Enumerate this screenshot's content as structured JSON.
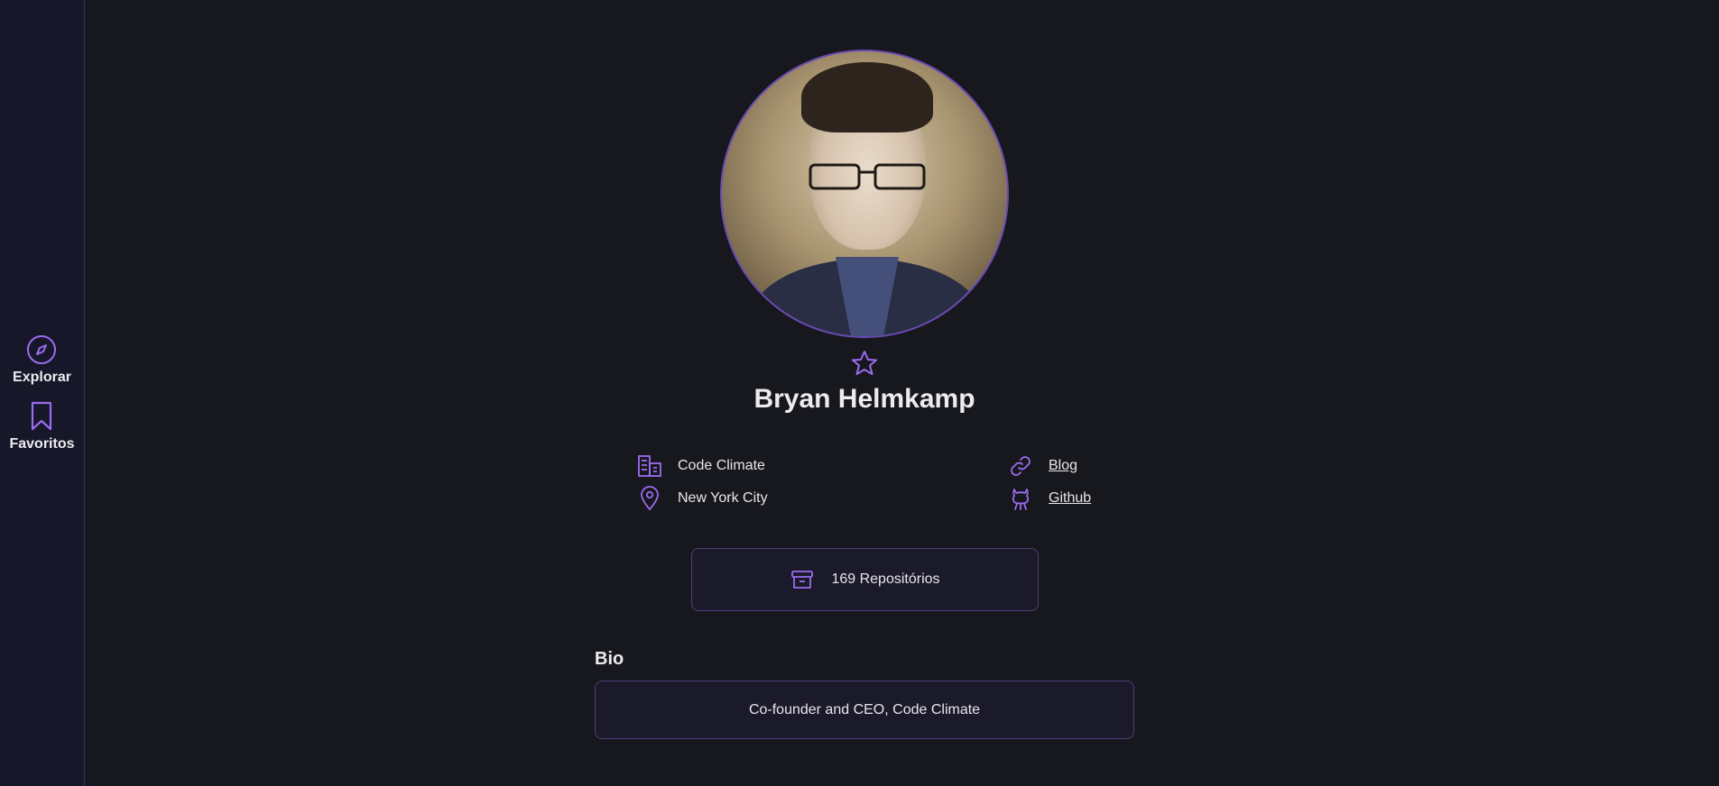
{
  "sidebar": {
    "items": [
      {
        "label": "Explorar",
        "icon": "compass-icon"
      },
      {
        "label": "Favoritos",
        "icon": "bookmark-icon"
      }
    ]
  },
  "profile": {
    "name": "Bryan Helmkamp",
    "favorite_icon": "star-icon",
    "company": "Code Climate",
    "location": "New York City",
    "blog_label": "Blog",
    "github_label": "Github",
    "repos_label": "169 Repositórios",
    "bio_title": "Bio",
    "bio": "Co-founder and CEO, Code Climate"
  },
  "colors": {
    "accent": "#9b6cf0",
    "background": "#17171e",
    "sidebar": "#17172a",
    "card_border": "#4b3f7a"
  }
}
